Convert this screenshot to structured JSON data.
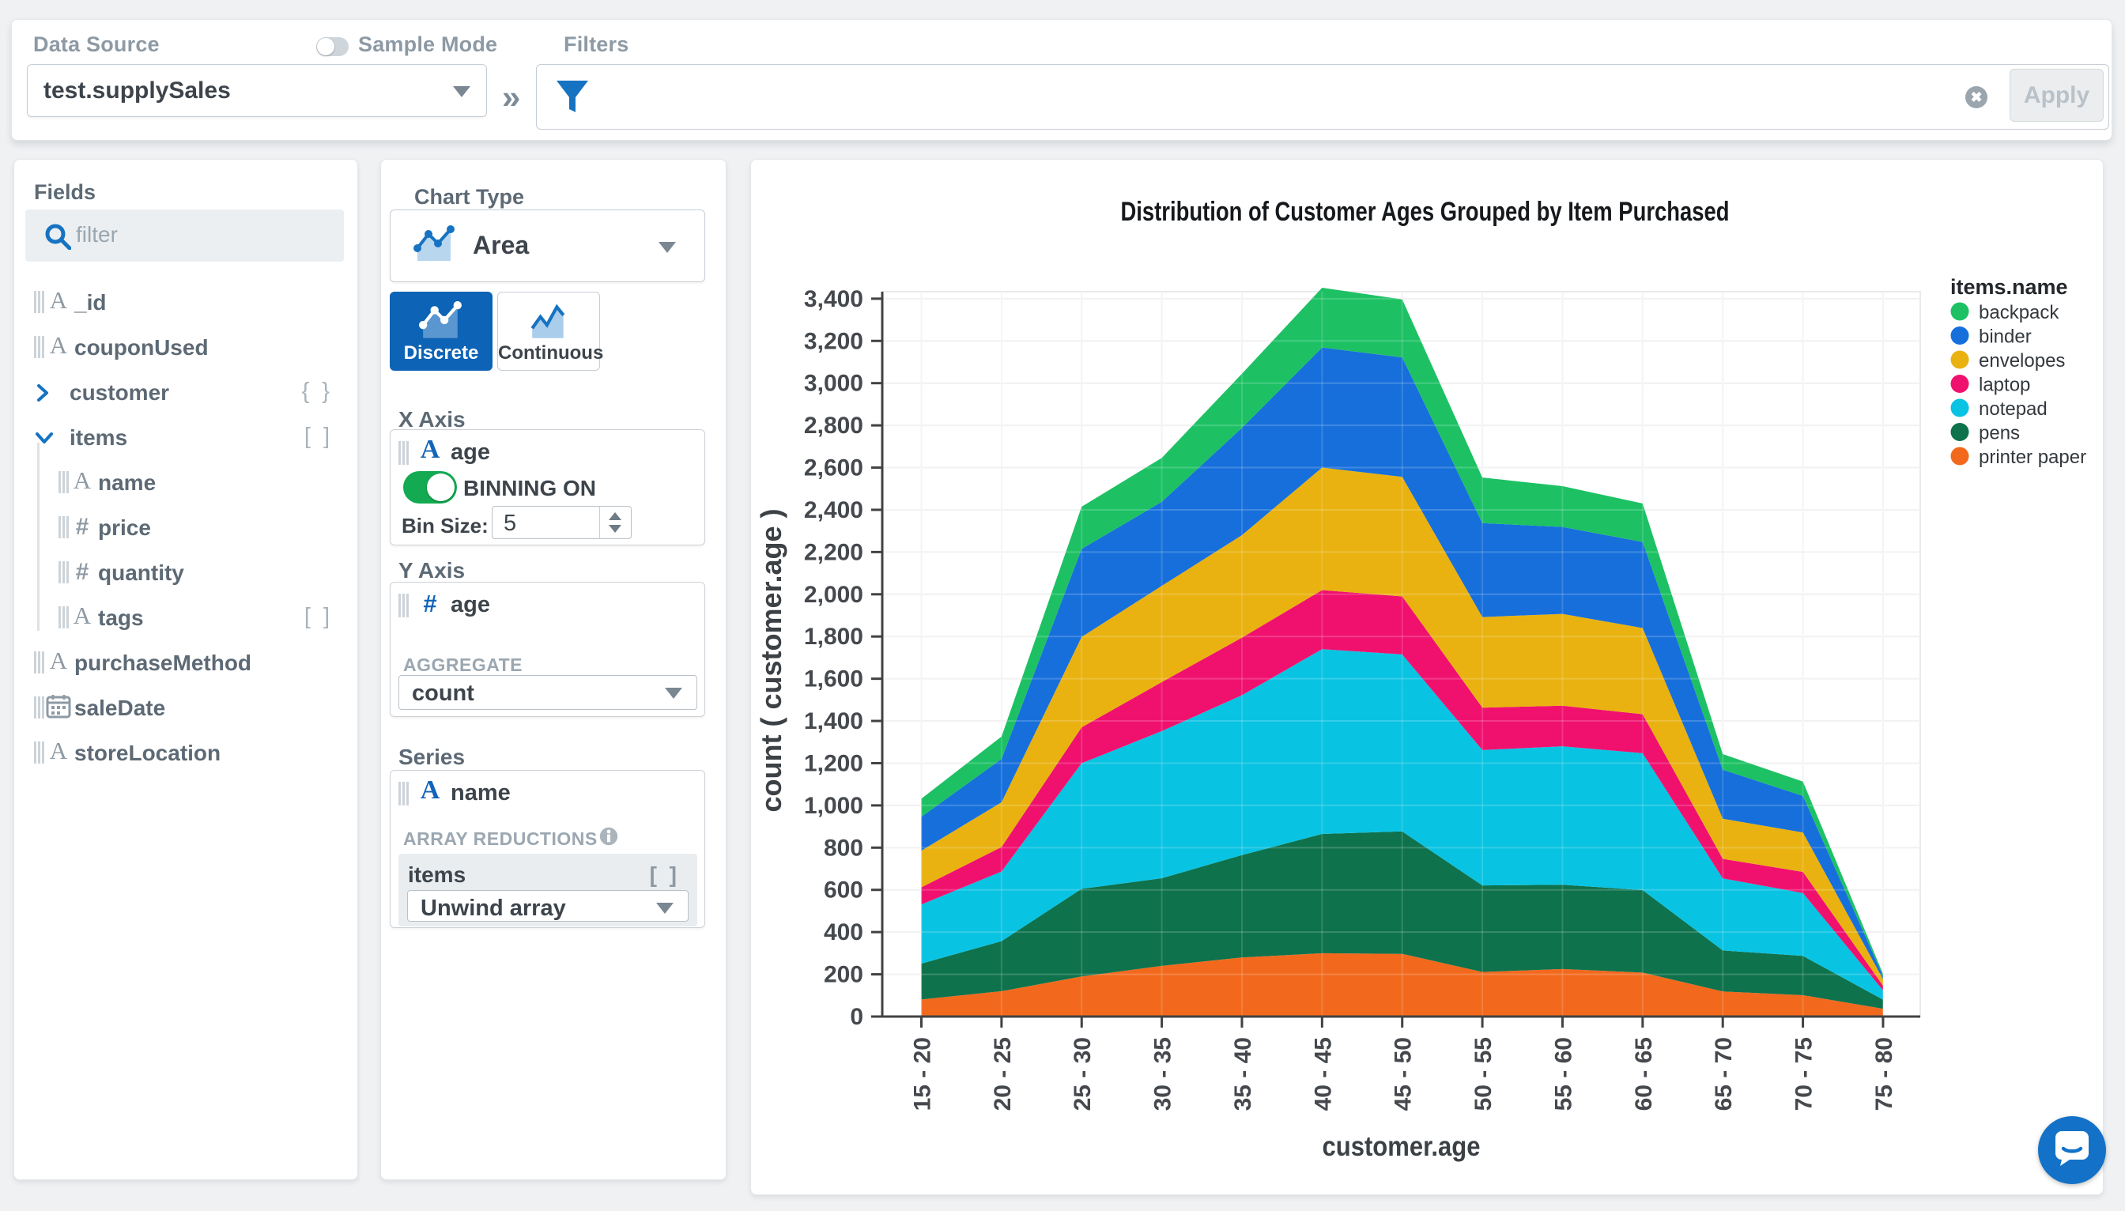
{
  "topbar": {
    "data_source_label": "Data Source",
    "data_source_value": "test.supplySales",
    "sample_mode_label": "Sample Mode",
    "sample_mode_on": false,
    "filters_label": "Filters",
    "filter_value": "",
    "apply_label": "Apply"
  },
  "fields_panel": {
    "title": "Fields",
    "search_placeholder": "filter",
    "items": [
      {
        "name": "_id",
        "type": "string",
        "depth": 0
      },
      {
        "name": "couponUsed",
        "type": "string",
        "depth": 0
      },
      {
        "name": "customer",
        "type": "object",
        "depth": 0,
        "expanded": false,
        "suffix": "{ }"
      },
      {
        "name": "items",
        "type": "array",
        "depth": 0,
        "expanded": true,
        "suffix": "[ ]"
      },
      {
        "name": "name",
        "type": "string",
        "depth": 1
      },
      {
        "name": "price",
        "type": "number",
        "depth": 1
      },
      {
        "name": "quantity",
        "type": "number",
        "depth": 1
      },
      {
        "name": "tags",
        "type": "string",
        "depth": 1,
        "suffix": "[ ]"
      },
      {
        "name": "purchaseMethod",
        "type": "string",
        "depth": 0
      },
      {
        "name": "saleDate",
        "type": "date",
        "depth": 0
      },
      {
        "name": "storeLocation",
        "type": "string",
        "depth": 0
      }
    ]
  },
  "builder_panel": {
    "chart_type_label": "Chart Type",
    "chart_type_value": "Area",
    "discrete_label": "Discrete",
    "continuous_label": "Continuous",
    "x_axis": {
      "title": "X Axis",
      "field": "age",
      "field_type": "string",
      "binning_label": "BINNING ON",
      "binning_on": true,
      "bin_size_label": "Bin Size:",
      "bin_size_value": "5"
    },
    "y_axis": {
      "title": "Y Axis",
      "field": "age",
      "field_type": "number",
      "aggregate_label": "AGGREGATE",
      "aggregate_value": "count"
    },
    "series": {
      "title": "Series",
      "field": "name",
      "field_type": "string",
      "array_reductions_label": "ARRAY REDUCTIONS",
      "array_field": "items",
      "array_suffix": "[ ]",
      "reduction_value": "Unwind array"
    }
  },
  "chart_data": {
    "type": "area",
    "stacked": true,
    "title": "Distribution of Customer Ages Grouped by Item Purchased",
    "xlabel": "customer.age",
    "ylabel": "count ( customer.age )",
    "legend_title": "items.name",
    "ylim": [
      0,
      3400
    ],
    "ytick_step": 200,
    "grid": true,
    "legend_position": "right",
    "categories": [
      "15 - 20",
      "20 - 25",
      "25 - 30",
      "30 - 35",
      "35 - 40",
      "40 - 45",
      "45 - 50",
      "50 - 55",
      "55 - 60",
      "60 - 65",
      "65 - 70",
      "70 - 75",
      "75 - 80"
    ],
    "series": [
      {
        "name": "backpack",
        "color": "#1dc164",
        "values": [
          86,
          106,
          200,
          208,
          257,
          283,
          275,
          216,
          193,
          182,
          74,
          68,
          10
        ]
      },
      {
        "name": "binder",
        "color": "#176fdb",
        "values": [
          160,
          205,
          417,
          398,
          508,
          569,
          566,
          445,
          412,
          408,
          232,
          173,
          15
        ]
      },
      {
        "name": "envelopes",
        "color": "#e9b210",
        "values": [
          174,
          212,
          428,
          456,
          485,
          580,
          566,
          429,
          435,
          408,
          190,
          187,
          31
        ]
      },
      {
        "name": "laptop",
        "color": "#f0116e",
        "values": [
          81,
          116,
          170,
          232,
          273,
          280,
          275,
          201,
          192,
          185,
          93,
          100,
          22
        ]
      },
      {
        "name": "notepad",
        "color": "#09c3e2",
        "values": [
          280,
          330,
          595,
          697,
          757,
          875,
          838,
          641,
          656,
          648,
          341,
          298,
          44
        ]
      },
      {
        "name": "pens",
        "color": "#0e724c",
        "values": [
          170,
          237,
          415,
          415,
          485,
          565,
          580,
          410,
          399,
          391,
          194,
          186,
          43
        ]
      },
      {
        "name": "printer paper",
        "color": "#f2691d",
        "values": [
          81,
          120,
          190,
          240,
          280,
          300,
          297,
          211,
          225,
          208,
          119,
          101,
          37
        ]
      }
    ],
    "stack_order_bottom_to_top": [
      "printer paper",
      "pens",
      "notepad",
      "laptop",
      "envelopes",
      "binder",
      "backpack"
    ]
  }
}
